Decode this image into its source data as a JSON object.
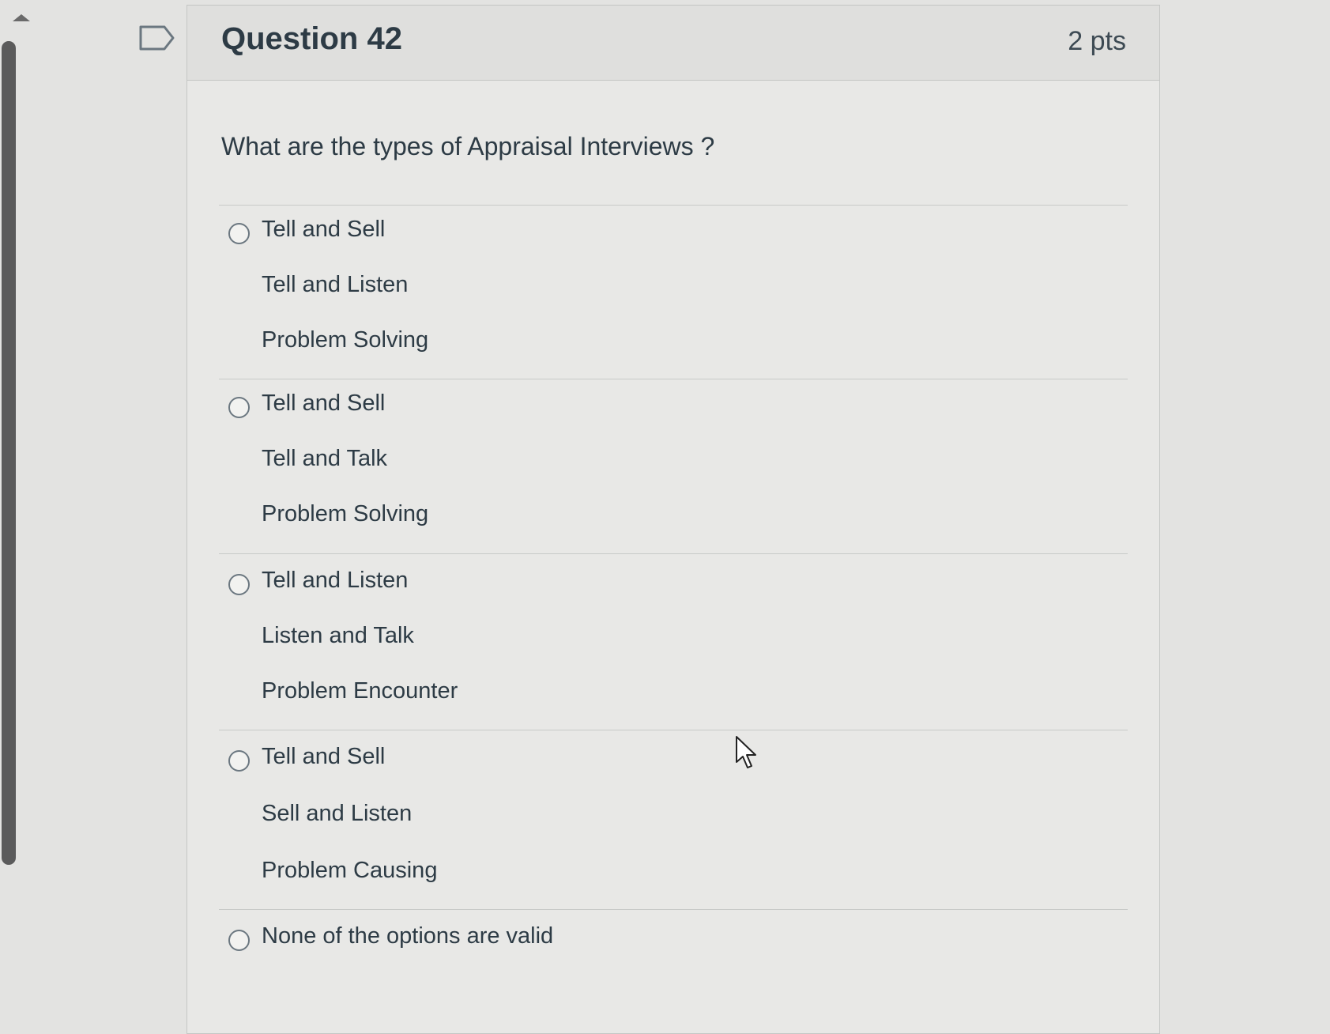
{
  "question": {
    "title": "Question 42",
    "points": "2 pts",
    "text": "What are the types of Appraisal Interviews ?"
  },
  "answers": [
    {
      "lines": [
        "Tell and Sell",
        "Tell and Listen",
        "Problem Solving"
      ]
    },
    {
      "lines": [
        "Tell and Sell",
        "Tell and Talk",
        "Problem Solving"
      ]
    },
    {
      "lines": [
        "Tell and Listen",
        "Listen and Talk",
        "Problem Encounter"
      ]
    },
    {
      "lines": [
        "Tell and Sell",
        "Sell and Listen",
        "Problem Causing"
      ]
    },
    {
      "lines": [
        "None of the options are valid"
      ]
    }
  ],
  "icons": {
    "flag": "flag-outline-icon",
    "scroll_up": "triangle-up-icon",
    "cursor": "mouse-pointer-icon"
  },
  "colors": {
    "text": "#2d3b45",
    "background": "#e3e3e1",
    "border": "#c4c6c4"
  }
}
